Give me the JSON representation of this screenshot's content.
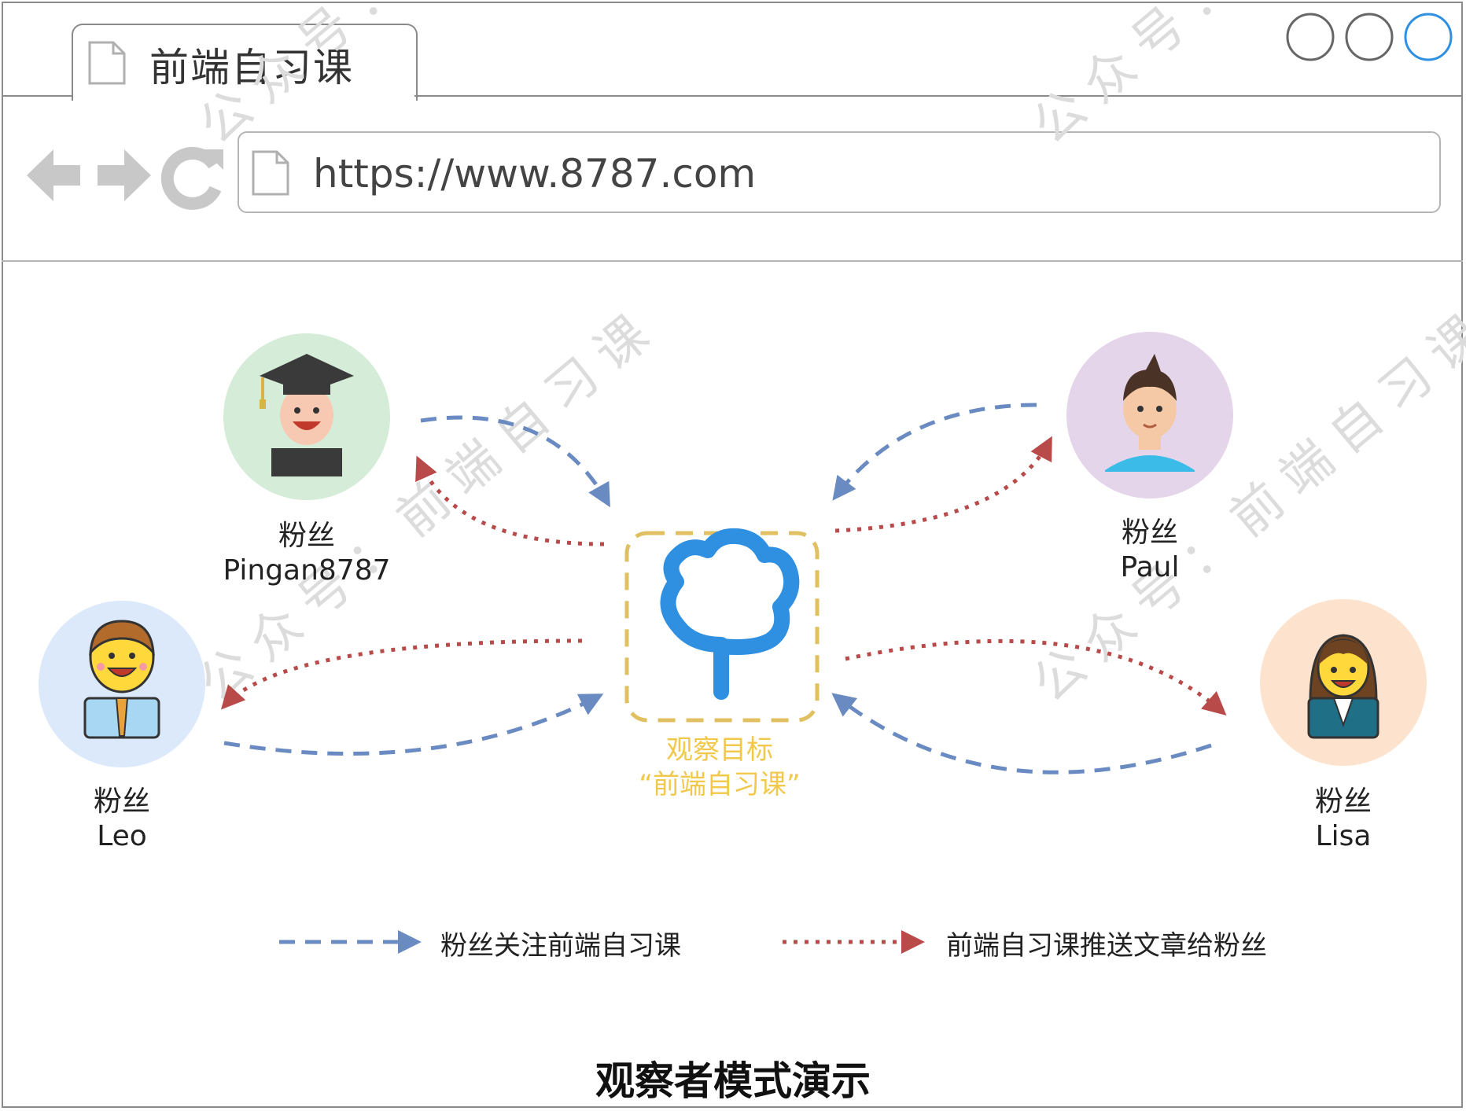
{
  "browser": {
    "tab_title": "前端自习课",
    "url": "https://www.8787.com"
  },
  "center": {
    "line1": "观察目标",
    "line2": "“前端自习课”"
  },
  "fans": [
    {
      "role": "粉丝",
      "name": "Pingan8787"
    },
    {
      "role": "粉丝",
      "name": "Paul"
    },
    {
      "role": "粉丝",
      "name": "Leo"
    },
    {
      "role": "粉丝",
      "name": "Lisa"
    }
  ],
  "legend": {
    "follow": "粉丝关注前端自习课",
    "push": "前端自习课推送文章给粉丝"
  },
  "caption": "观察者模式演示",
  "watermark": [
    "公众号：前端自习课"
  ],
  "colors": {
    "follow": "#6a8bc2",
    "push": "#b84a4a",
    "observer": "#e0c060",
    "logo": "#2f8fe0"
  }
}
